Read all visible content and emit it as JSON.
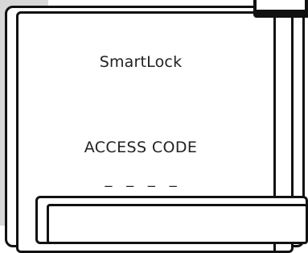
{
  "screen": {
    "device_name": "SmartLock",
    "access_label": "ACCESS CODE",
    "code_slots": [
      "_",
      "_",
      "_",
      "_"
    ]
  }
}
